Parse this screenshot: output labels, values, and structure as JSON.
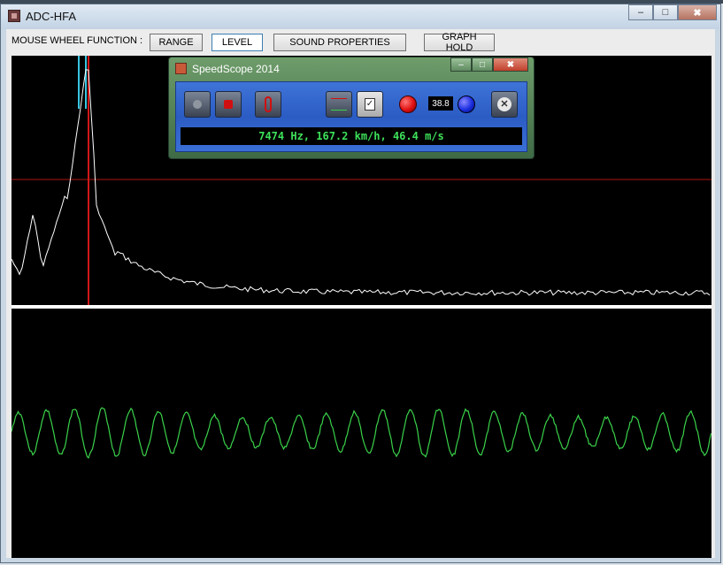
{
  "window": {
    "title": "ADC-HFA",
    "minimize_glyph": "‒",
    "maximize_glyph": "□",
    "close_glyph": "✖"
  },
  "toolbar": {
    "label": "MOUSE WHEEL FUNCTION :",
    "buttons": [
      {
        "label": "RANGE",
        "active": false
      },
      {
        "label": "LEVEL",
        "active": true
      },
      {
        "label": "SOUND PROPERTIES",
        "active": false
      },
      {
        "label": "GRAPH HOLD",
        "active": false
      }
    ]
  },
  "colors": {
    "spectrum": "#ffffff",
    "cursor_vertical": "#d01818",
    "cursor_horizontal": "#b01616",
    "marker": "#39c6e0",
    "waveform": "#3ad24a"
  },
  "speedscope": {
    "title": "SpeedScope 2014",
    "value_display": "38.8",
    "readout": "7474 Hz, 167.2 km/h, 46.4 m/s",
    "buttons": [
      {
        "icon": "record-dot-icon"
      },
      {
        "icon": "stop-icon"
      },
      {
        "icon": "pause-icon"
      },
      {
        "icon": "crosshair-icon"
      },
      {
        "icon": "checklist-icon"
      }
    ],
    "leds": [
      {
        "icon": "red-led-icon",
        "color": "#e01010"
      },
      {
        "icon": "blue-led-icon",
        "color": "#1a2ee0"
      }
    ],
    "close_icon": "close-x-icon"
  },
  "spectrum_graph": {
    "peak_freq_label_visible": false,
    "peak_level": 1.0
  },
  "waveform_graph": {
    "cycles_visible": 25
  }
}
